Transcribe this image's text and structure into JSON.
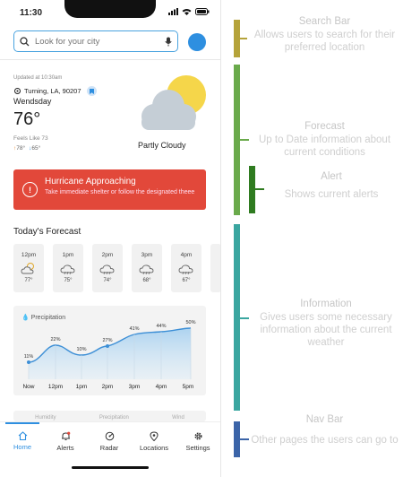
{
  "status": {
    "time": "11:30"
  },
  "search": {
    "placeholder": "Look for your city"
  },
  "current": {
    "updated": "Updated at 10:30am",
    "location": "Turning, LA, 90207",
    "day": "Wendsday",
    "temp": "76°",
    "feels": "Feels Like 73",
    "high": "78°",
    "low": "65°",
    "condition": "Partly Cloudy"
  },
  "alert": {
    "title": "Hurricane Approaching",
    "desc": "Take immediate shelter or follow the designated theee"
  },
  "forecast": {
    "title": "Today's Forecast",
    "hours": [
      {
        "time": "12pm",
        "temp": "77°",
        "icon": "sun-cloud-icon"
      },
      {
        "time": "1pm",
        "temp": "75°",
        "icon": "cloud-icon"
      },
      {
        "time": "2pm",
        "temp": "74°",
        "icon": "cloud-icon"
      },
      {
        "time": "3pm",
        "temp": "68°",
        "icon": "cloud-icon"
      },
      {
        "time": "4pm",
        "temp": "67°",
        "icon": "cloud-icon"
      }
    ]
  },
  "precip": {
    "title": "Precipitation",
    "labels": [
      "Now",
      "12pm",
      "1pm",
      "2pm",
      "3pm",
      "4pm",
      "5pm"
    ],
    "values": [
      "11%",
      "22%",
      "10%",
      "27%",
      "41%",
      "44%",
      "50%"
    ]
  },
  "peek": {
    "a": "Humidity",
    "b": "Precipitation",
    "c": "Wind"
  },
  "nav": {
    "home": "Home",
    "alerts": "Alerts",
    "radar": "Radar",
    "locations": "Locations",
    "settings": "Settings"
  },
  "annotations": {
    "search_title": "Search Bar",
    "search_desc": "Allows users to search for their preferred location",
    "forecast_title": "Forecast",
    "forecast_desc": "Up to Date information about current conditions",
    "alert_title": "Alert",
    "alert_desc": "Shows current alerts",
    "info_title": "Information",
    "info_desc": "Gives users some necessary information about the current weather",
    "nav_title": "Nav Bar",
    "nav_desc": "Other pages the users can go to"
  },
  "colors": {
    "accent": "#2e8fe0",
    "alert": "#e2483a",
    "search_bar": "#b5a33a",
    "forecast_bar": "#6aaa4b",
    "alert_bar": "#2f7b20",
    "info_bar": "#3aa6a0",
    "nav_bar": "#3b64a8"
  }
}
